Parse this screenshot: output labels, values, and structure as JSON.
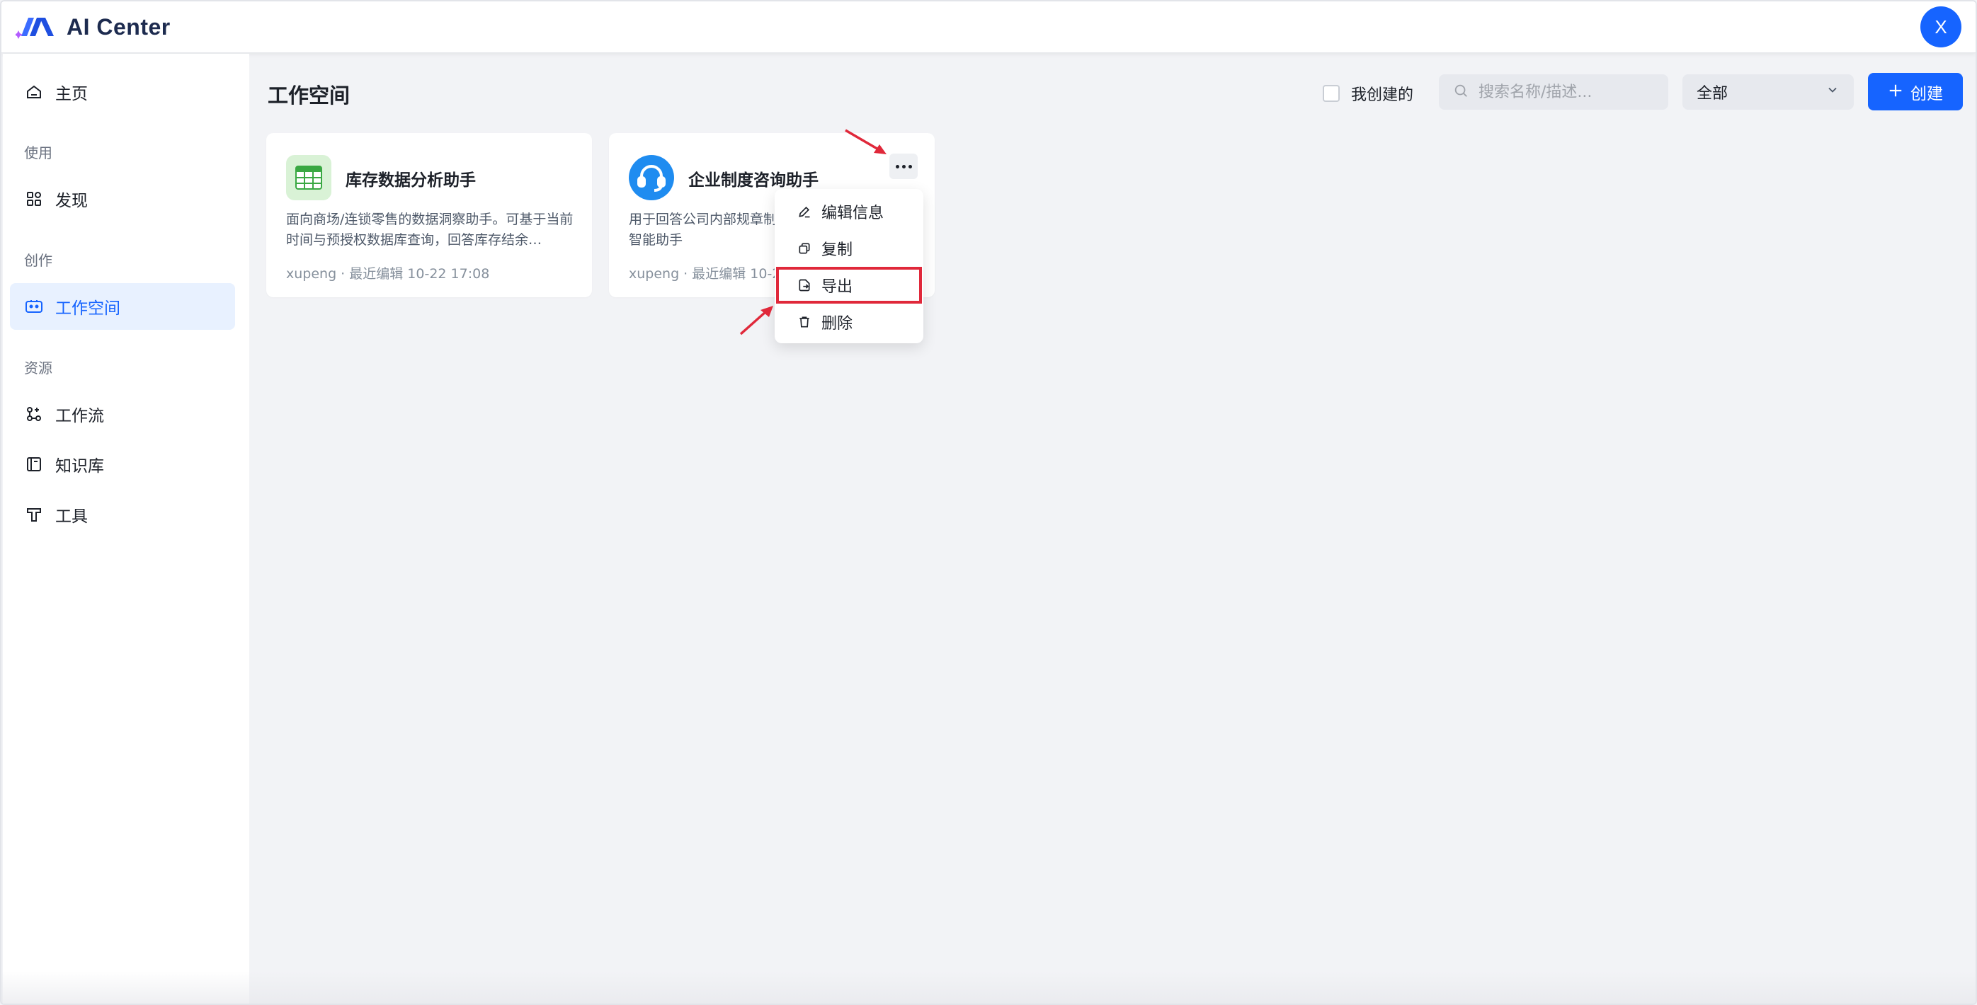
{
  "app": {
    "title": "AI Center",
    "avatar_initial": "X"
  },
  "colors": {
    "accent": "#1664ff",
    "highlight": "#e0283a",
    "background": "#f2f3f6"
  },
  "sidebar": {
    "home": {
      "label": "主页",
      "icon": "home-icon"
    },
    "sections": [
      {
        "title": "使用",
        "items": [
          {
            "label": "发现",
            "icon": "discover-grid-icon"
          }
        ]
      },
      {
        "title": "创作",
        "items": [
          {
            "label": "工作空间",
            "icon": "workspace-icon",
            "active": true
          }
        ]
      },
      {
        "title": "资源",
        "items": [
          {
            "label": "工作流",
            "icon": "workflow-icon"
          },
          {
            "label": "知识库",
            "icon": "knowledge-base-icon"
          },
          {
            "label": "工具",
            "icon": "tool-icon"
          }
        ]
      }
    ]
  },
  "main": {
    "title": "工作空间",
    "filter_mine_label": "我创建的",
    "search_placeholder": "搜索名称/描述...",
    "select_value": "全部",
    "create_label": "创建",
    "cards": [
      {
        "title": "库存数据分析助手",
        "description": "面向商场/连锁零售的数据洞察助手。可基于当前时间与预授权数据库查询，回答库存结余…",
        "meta": "xupeng · 最近编辑 10-22 17:08",
        "icon": "table-sheet-icon"
      },
      {
        "title": "企业制度咨询助手",
        "description": "用于回答公司内部规章制度、规范等常见问题的智能助手",
        "meta": "xupeng · 最近编辑 10-22 17:08",
        "icon": "headset-icon"
      }
    ],
    "context_menu": {
      "items": [
        {
          "label": "编辑信息",
          "icon": "edit-pen-icon"
        },
        {
          "label": "复制",
          "icon": "copy-icon"
        },
        {
          "label": "导出",
          "icon": "export-icon",
          "highlighted": true
        },
        {
          "label": "删除",
          "icon": "trash-icon"
        }
      ]
    }
  }
}
